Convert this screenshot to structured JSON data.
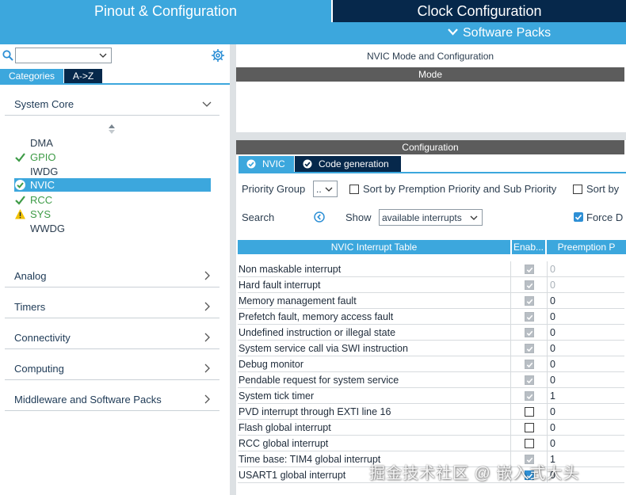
{
  "top_tabs": {
    "pinout": "Pinout & Configuration",
    "clock": "Clock Configuration",
    "software_packs": "Software Packs"
  },
  "left": {
    "search_value": "",
    "tabs": {
      "categories": "Categories",
      "az": "A->Z"
    },
    "groups": {
      "system_core": "System Core",
      "analog": "Analog",
      "timers": "Timers",
      "connectivity": "Connectivity",
      "computing": "Computing",
      "middleware": "Middleware and Software Packs"
    },
    "peripherals": [
      {
        "label": "DMA",
        "status": "none"
      },
      {
        "label": "GPIO",
        "status": "ok"
      },
      {
        "label": "IWDG",
        "status": "none"
      },
      {
        "label": "NVIC",
        "status": "ok-selected"
      },
      {
        "label": "RCC",
        "status": "ok"
      },
      {
        "label": "SYS",
        "status": "warning"
      },
      {
        "label": "WWDG",
        "status": "none"
      }
    ]
  },
  "right": {
    "title": "NVIC Mode and Configuration",
    "mode_label": "Mode",
    "configuration_label": "Configuration",
    "tabs": {
      "nvic": "NVIC",
      "code_generation": "Code generation"
    },
    "priority_group_label": "Priority Group",
    "priority_group_value": "..",
    "sort_premption_label": "Sort by Premption Priority and Sub Priority",
    "sort_by_label": "Sort by",
    "search_label": "Search",
    "show_label": "Show",
    "show_value": "available interrupts",
    "force_label": "Force D",
    "table": {
      "headers": {
        "name": "NVIC Interrupt Table",
        "enabled": "Enab...",
        "preemption": "Preemption P"
      },
      "rows": [
        {
          "name": "Non maskable interrupt",
          "enabled": "locked",
          "pre": "0",
          "dim": true
        },
        {
          "name": "Hard fault interrupt",
          "enabled": "locked",
          "pre": "0",
          "dim": true
        },
        {
          "name": "Memory management fault",
          "enabled": "locked",
          "pre": "0",
          "dim": false
        },
        {
          "name": "Prefetch fault, memory access fault",
          "enabled": "locked",
          "pre": "0",
          "dim": false
        },
        {
          "name": "Undefined instruction or illegal state",
          "enabled": "locked",
          "pre": "0",
          "dim": false
        },
        {
          "name": "System service call via SWI instruction",
          "enabled": "locked",
          "pre": "0",
          "dim": false
        },
        {
          "name": "Debug monitor",
          "enabled": "locked",
          "pre": "0",
          "dim": false
        },
        {
          "name": "Pendable request for system service",
          "enabled": "locked",
          "pre": "0",
          "dim": false
        },
        {
          "name": "System tick timer",
          "enabled": "locked",
          "pre": "1",
          "dim": false
        },
        {
          "name": "PVD interrupt through EXTI line 16",
          "enabled": "free",
          "pre": "0",
          "dim": false
        },
        {
          "name": "Flash global interrupt",
          "enabled": "free",
          "pre": "0",
          "dim": false
        },
        {
          "name": "RCC global interrupt",
          "enabled": "free",
          "pre": "0",
          "dim": false
        },
        {
          "name": "Time base: TIM4 global interrupt",
          "enabled": "locked",
          "pre": "1",
          "dim": false
        },
        {
          "name": "USART1 global interrupt",
          "enabled": "on",
          "pre": "0",
          "dim": false
        }
      ]
    }
  },
  "watermark": "掘金技术社区 @ 嵌入式大头",
  "colors": {
    "accent": "#3ca7dd",
    "dark": "#06284b",
    "ok": "#3e9b47",
    "warn": "#f2c200",
    "section": "#5c5c5c"
  }
}
